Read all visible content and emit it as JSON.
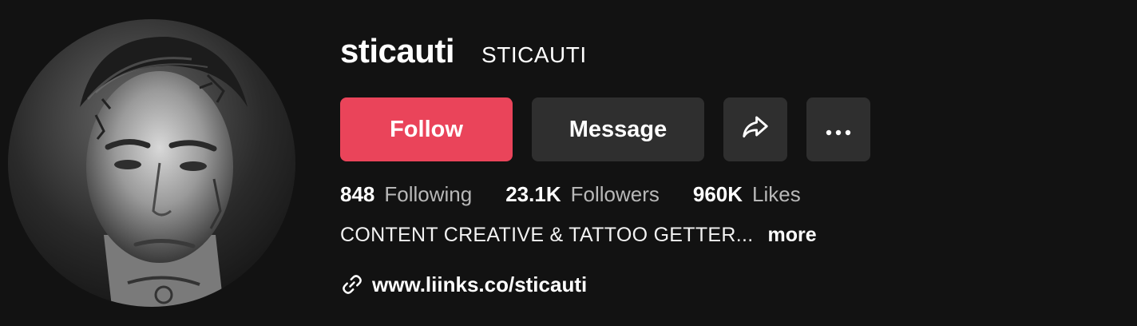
{
  "profile": {
    "username": "sticauti",
    "display_name": "STICAUTI",
    "avatar": "profile-photo"
  },
  "actions": {
    "follow_label": "Follow",
    "message_label": "Message",
    "share_icon": "share-icon",
    "more_icon": "more-options-icon"
  },
  "stats": {
    "following_count": "848",
    "following_label": "Following",
    "followers_count": "23.1K",
    "followers_label": "Followers",
    "likes_count": "960K",
    "likes_label": "Likes"
  },
  "bio": {
    "text": "CONTENT CREATIVE & TATTOO GETTER...",
    "more_label": "more"
  },
  "link": {
    "icon": "link-icon",
    "url": "www.liinks.co/sticauti"
  },
  "colors": {
    "background": "#121212",
    "follow_button": "#ea445a",
    "secondary_button": "#2f2f2f",
    "muted_text": "#b8b8b8"
  }
}
